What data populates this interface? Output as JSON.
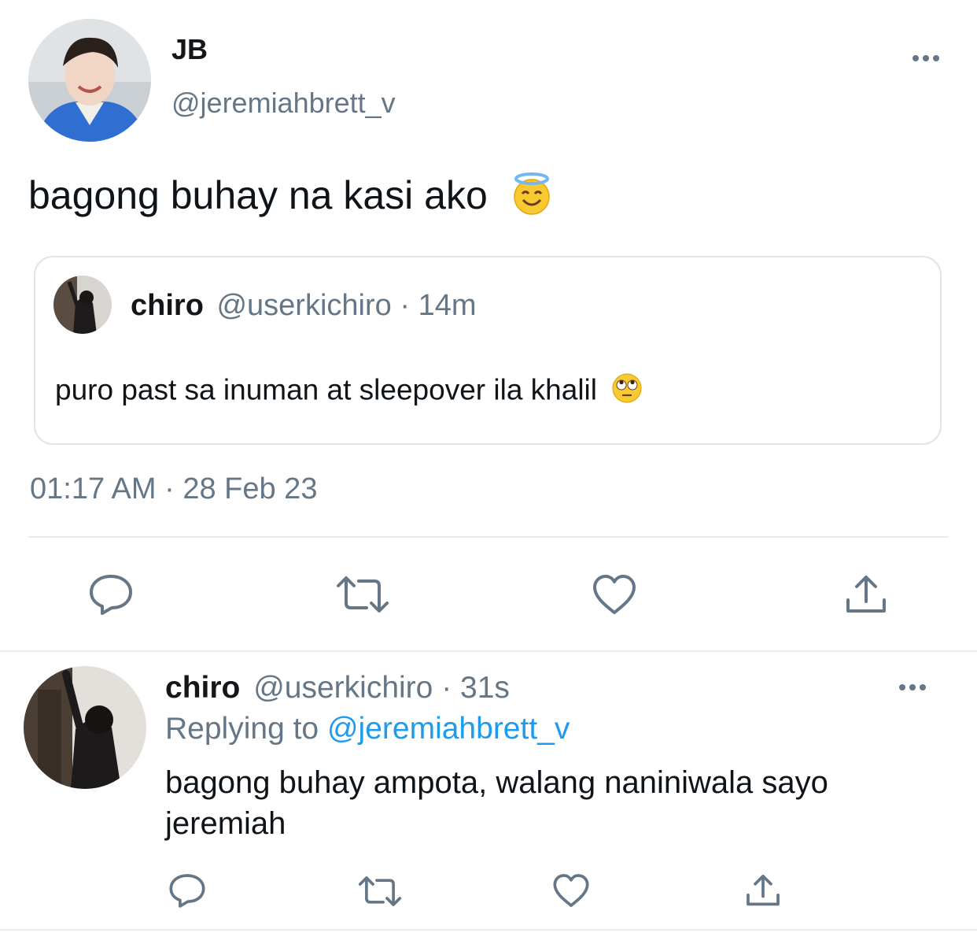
{
  "main_tweet": {
    "author": {
      "name": "JB",
      "handle": "@jeremiahbrett_v"
    },
    "text": "bagong buhay na kasi ako",
    "emoji_icon": "smiling-face-with-halo-icon",
    "quoted": {
      "name": "chiro",
      "handle": "@userkichiro",
      "sep": "·",
      "time": "14m",
      "text": "puro past sa inuman at sleepover ila khalil",
      "emoji_icon": "face-with-rolling-eyes-icon"
    },
    "timestamp": "01:17 AM · 28 Feb 23",
    "actions": [
      "reply-icon",
      "retweet-icon",
      "like-icon",
      "share-icon"
    ]
  },
  "reply_tweet": {
    "author": {
      "name": "chiro",
      "handle": "@userkichiro"
    },
    "sep": "·",
    "time": "31s",
    "replying_prefix": "Replying to",
    "replying_to": "@jeremiahbrett_v",
    "text_line1": "bagong buhay ampota, walang naniniwala sayo",
    "text_line2": "jeremiah",
    "actions": [
      "reply-icon",
      "retweet-icon",
      "like-icon",
      "share-icon"
    ]
  },
  "colors": {
    "text": "#14171a",
    "secondary": "#657786",
    "link": "#1d9bf0",
    "divider": "#e6ecf0"
  }
}
